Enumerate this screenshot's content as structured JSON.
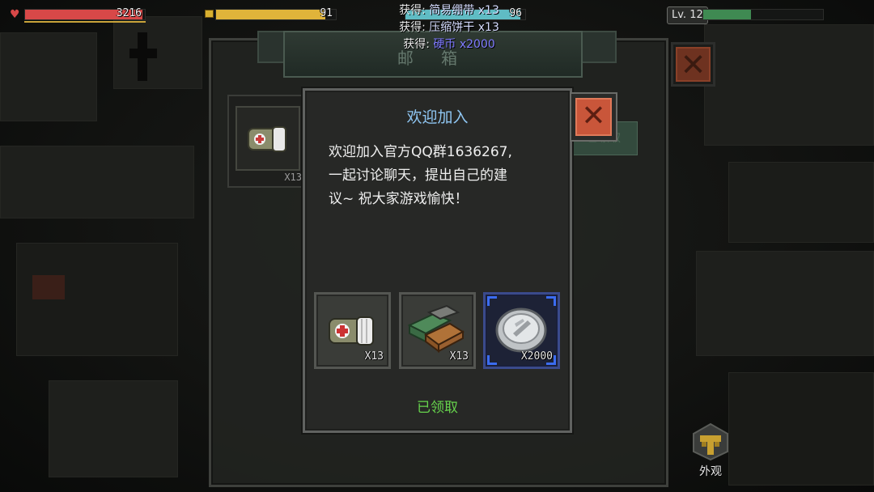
{
  "hud": {
    "health": {
      "value": "3216",
      "fraction": 0.98,
      "color": "#d84848"
    },
    "hunger": {
      "value": "91",
      "fraction": 0.91,
      "color": "#e0b43a"
    },
    "water": {
      "value": "96",
      "fraction": 0.96,
      "color": "#5fbcc4"
    },
    "level": {
      "label": "Lv. 12",
      "fraction": 0.4,
      "color": "#3f8a52"
    }
  },
  "toasts": [
    {
      "prefix": "获得: ",
      "item": "简易绷带 x13"
    },
    {
      "prefix": "获得: ",
      "item": "压缩饼干 x13"
    },
    {
      "prefix": "获得: ",
      "item": "硬币 x2000"
    }
  ],
  "mailbox": {
    "title": "邮 箱",
    "slot_qty": "X13",
    "claim_label": "已领取",
    "close_icon": "close-x-icon"
  },
  "dialog": {
    "title": "欢迎加入",
    "message_lines": [
      "欢迎加入官方QQ群1636267,",
      "一起讨论聊天，提出自己的建",
      "议~ 祝大家游戏愉快！"
    ],
    "rewards": [
      {
        "name": "bandage-icon",
        "qty": "X13"
      },
      {
        "name": "compressed-biscuit-icon",
        "qty": "X13"
      },
      {
        "name": "coin-icon",
        "qty": "X2000",
        "selected": true
      }
    ],
    "claim_status": "已领取",
    "close_icon": "close-x-icon"
  },
  "outfit": {
    "label": "外观",
    "icon": "outfit-icon"
  }
}
